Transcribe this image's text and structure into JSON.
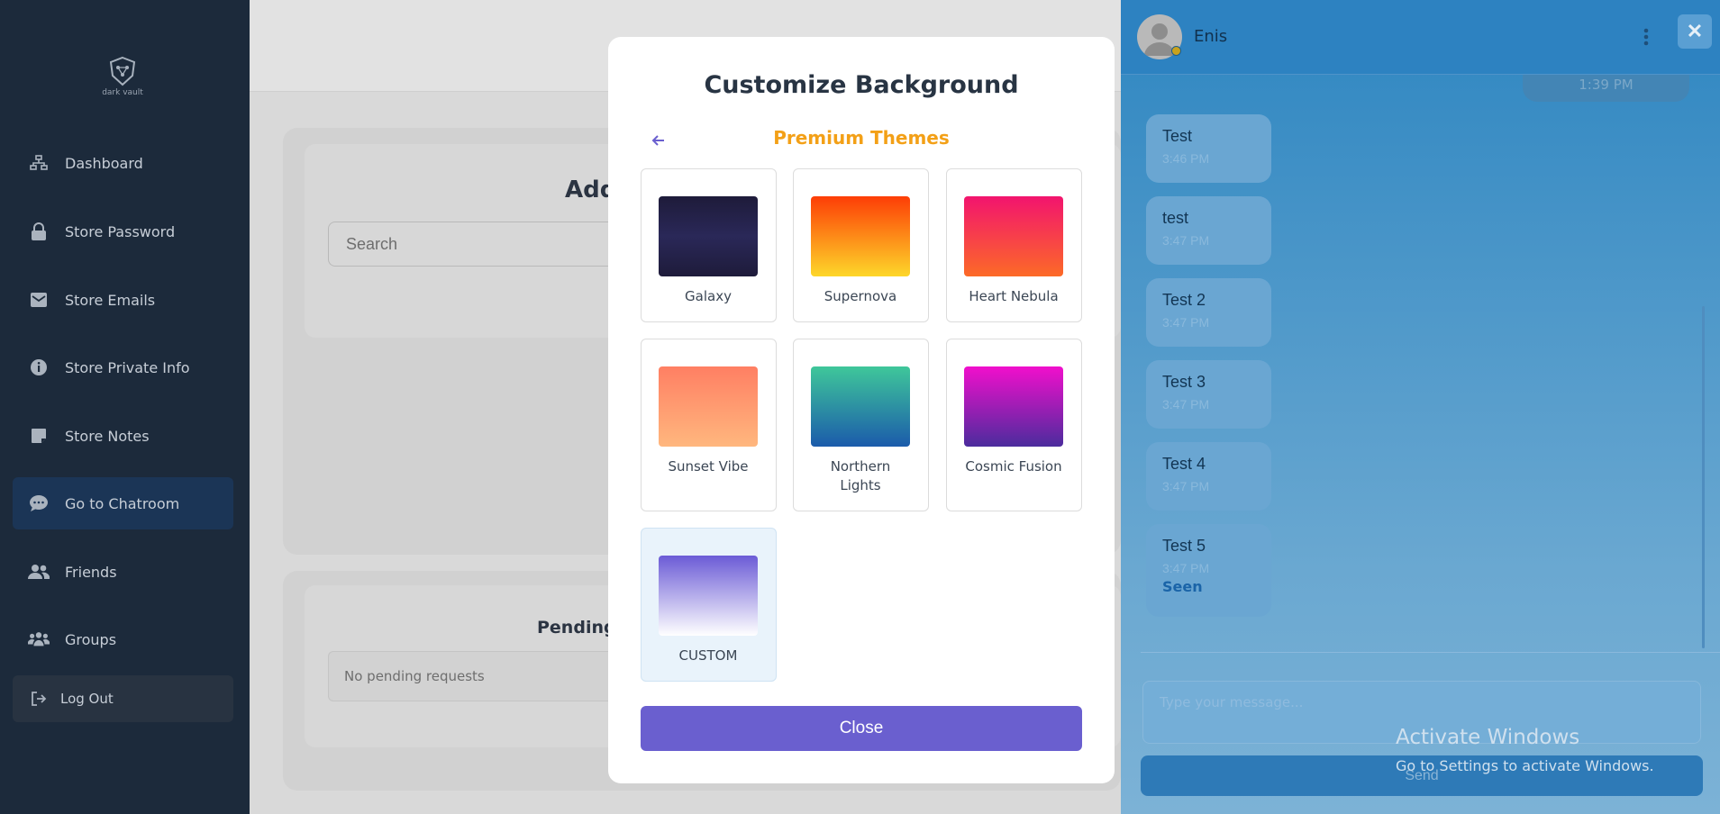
{
  "app": {
    "logo_text": "dark vault"
  },
  "sidebar": {
    "items": [
      {
        "label": "Dashboard",
        "icon": "sitemap-icon"
      },
      {
        "label": "Store Password",
        "icon": "lock-icon"
      },
      {
        "label": "Store Emails",
        "icon": "envelope-icon"
      },
      {
        "label": "Store Private Info",
        "icon": "info-icon"
      },
      {
        "label": "Store Notes",
        "icon": "note-icon"
      },
      {
        "label": "Go to Chatroom",
        "icon": "chat-icon",
        "active": true
      },
      {
        "label": "Friends",
        "icon": "users-icon"
      },
      {
        "label": "Groups",
        "icon": "groups-icon"
      }
    ],
    "logout_label": "Log Out"
  },
  "background_page": {
    "add_title": "Add",
    "search_placeholder": "Search",
    "pending_title": "Pending",
    "pending_empty": "No pending requests"
  },
  "modal": {
    "title": "Customize Background",
    "section_title": "Premium Themes",
    "themes": [
      {
        "label": "Galaxy",
        "colors": [
          "#1f1b3d",
          "#2b2a5c"
        ]
      },
      {
        "label": "Supernova",
        "colors": [
          "#fd3d06",
          "#fdd72a"
        ]
      },
      {
        "label": "Heart Nebula",
        "colors": [
          "#f2146e",
          "#fc6a27"
        ]
      },
      {
        "label": "Sunset Vibe",
        "colors": [
          "#ff7f63",
          "#ffb77e"
        ]
      },
      {
        "label": "Northern Lights",
        "colors": [
          "#3fc79a",
          "#1b5bab"
        ]
      },
      {
        "label": "Cosmic Fusion",
        "colors": [
          "#f10fcc",
          "#4b2c9d"
        ]
      },
      {
        "label": "CUSTOM",
        "colors": [
          "#6b5bd6",
          "#ffffff"
        ],
        "selected": true
      }
    ],
    "close_label": "Close"
  },
  "chat": {
    "contact_name": "Enis",
    "status_color": "#c9a21d",
    "top_message_time": "1:39 PM",
    "messages": [
      {
        "text": "Test",
        "time": "3:46 PM"
      },
      {
        "text": "test",
        "time": "3:47 PM"
      },
      {
        "text": "Test 2",
        "time": "3:47 PM"
      },
      {
        "text": "Test 3",
        "time": "3:47 PM"
      },
      {
        "text": "Test 4",
        "time": "3:47 PM"
      },
      {
        "text": "Test 5",
        "time": "3:47 PM",
        "seen": "Seen"
      }
    ],
    "input_placeholder": "Type your message...",
    "send_label": "Send"
  },
  "watermark": {
    "title": "Activate Windows",
    "subtitle": "Go to Settings to activate Windows."
  }
}
